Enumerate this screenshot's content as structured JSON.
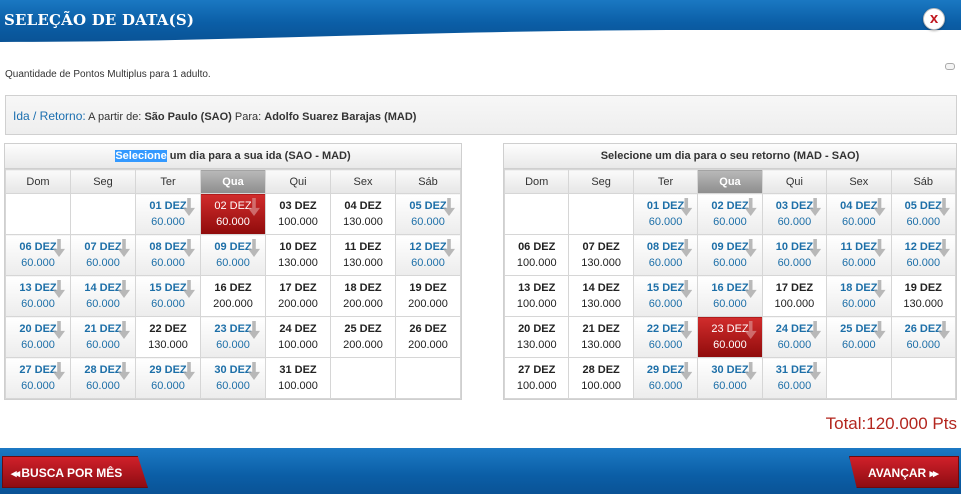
{
  "header": {
    "title": "SELEÇÃO DE DATA(S)",
    "close_label": "x"
  },
  "points_note": "Quantidade de Pontos Multiplus para 1 adulto.",
  "route": {
    "label": "Ida / Retorno:",
    "from_prefix": "A partir de:",
    "from": "São Paulo (SAO)",
    "to_prefix": "Para:",
    "to": "Adolfo Suarez Barajas (MAD)"
  },
  "weekdays": [
    "Dom",
    "Seg",
    "Ter",
    "Qua",
    "Qui",
    "Sex",
    "Sáb"
  ],
  "today_col": 3,
  "ida": {
    "caption_highlight": "Selecione",
    "caption_rest": " um dia para a sua ida (SAO - MAD)",
    "rows": [
      [
        null,
        null,
        {
          "d": "01 DEZ",
          "p": "60.000",
          "s": "avail"
        },
        {
          "d": "02 DEZ",
          "p": "60.000",
          "s": "sel"
        },
        {
          "d": "03 DEZ",
          "p": "100.000",
          "s": "plain"
        },
        {
          "d": "04 DEZ",
          "p": "130.000",
          "s": "plain"
        },
        {
          "d": "05 DEZ",
          "p": "60.000",
          "s": "avail"
        }
      ],
      [
        {
          "d": "06 DEZ",
          "p": "60.000",
          "s": "avail"
        },
        {
          "d": "07 DEZ",
          "p": "60.000",
          "s": "avail"
        },
        {
          "d": "08 DEZ",
          "p": "60.000",
          "s": "avail"
        },
        {
          "d": "09 DEZ",
          "p": "60.000",
          "s": "avail"
        },
        {
          "d": "10 DEZ",
          "p": "130.000",
          "s": "plain"
        },
        {
          "d": "11 DEZ",
          "p": "130.000",
          "s": "plain"
        },
        {
          "d": "12 DEZ",
          "p": "60.000",
          "s": "avail"
        }
      ],
      [
        {
          "d": "13 DEZ",
          "p": "60.000",
          "s": "avail"
        },
        {
          "d": "14 DEZ",
          "p": "60.000",
          "s": "avail"
        },
        {
          "d": "15 DEZ",
          "p": "60.000",
          "s": "avail"
        },
        {
          "d": "16 DEZ",
          "p": "200.000",
          "s": "plain"
        },
        {
          "d": "17 DEZ",
          "p": "200.000",
          "s": "plain"
        },
        {
          "d": "18 DEZ",
          "p": "200.000",
          "s": "plain"
        },
        {
          "d": "19 DEZ",
          "p": "200.000",
          "s": "plain"
        }
      ],
      [
        {
          "d": "20 DEZ",
          "p": "60.000",
          "s": "avail"
        },
        {
          "d": "21 DEZ",
          "p": "60.000",
          "s": "avail"
        },
        {
          "d": "22 DEZ",
          "p": "130.000",
          "s": "plain"
        },
        {
          "d": "23 DEZ",
          "p": "60.000",
          "s": "avail"
        },
        {
          "d": "24 DEZ",
          "p": "100.000",
          "s": "plain"
        },
        {
          "d": "25 DEZ",
          "p": "200.000",
          "s": "plain"
        },
        {
          "d": "26 DEZ",
          "p": "200.000",
          "s": "plain"
        }
      ],
      [
        {
          "d": "27 DEZ",
          "p": "60.000",
          "s": "avail"
        },
        {
          "d": "28 DEZ",
          "p": "60.000",
          "s": "avail"
        },
        {
          "d": "29 DEZ",
          "p": "60.000",
          "s": "avail"
        },
        {
          "d": "30 DEZ",
          "p": "60.000",
          "s": "avail"
        },
        {
          "d": "31 DEZ",
          "p": "100.000",
          "s": "plain"
        },
        null,
        null
      ]
    ]
  },
  "retorno": {
    "caption": "Selecione um dia para o seu retorno (MAD - SAO)",
    "rows": [
      [
        null,
        null,
        {
          "d": "01 DEZ",
          "p": "60.000",
          "s": "avail"
        },
        {
          "d": "02 DEZ",
          "p": "60.000",
          "s": "avail"
        },
        {
          "d": "03 DEZ",
          "p": "60.000",
          "s": "avail"
        },
        {
          "d": "04 DEZ",
          "p": "60.000",
          "s": "avail"
        },
        {
          "d": "05 DEZ",
          "p": "60.000",
          "s": "avail"
        }
      ],
      [
        {
          "d": "06 DEZ",
          "p": "100.000",
          "s": "plain"
        },
        {
          "d": "07 DEZ",
          "p": "130.000",
          "s": "plain"
        },
        {
          "d": "08 DEZ",
          "p": "60.000",
          "s": "avail"
        },
        {
          "d": "09 DEZ",
          "p": "60.000",
          "s": "avail"
        },
        {
          "d": "10 DEZ",
          "p": "60.000",
          "s": "avail"
        },
        {
          "d": "11 DEZ",
          "p": "60.000",
          "s": "avail"
        },
        {
          "d": "12 DEZ",
          "p": "60.000",
          "s": "avail"
        }
      ],
      [
        {
          "d": "13 DEZ",
          "p": "100.000",
          "s": "plain"
        },
        {
          "d": "14 DEZ",
          "p": "130.000",
          "s": "plain"
        },
        {
          "d": "15 DEZ",
          "p": "60.000",
          "s": "avail"
        },
        {
          "d": "16 DEZ",
          "p": "60.000",
          "s": "avail"
        },
        {
          "d": "17 DEZ",
          "p": "100.000",
          "s": "plain"
        },
        {
          "d": "18 DEZ",
          "p": "60.000",
          "s": "avail"
        },
        {
          "d": "19 DEZ",
          "p": "130.000",
          "s": "plain"
        }
      ],
      [
        {
          "d": "20 DEZ",
          "p": "130.000",
          "s": "plain"
        },
        {
          "d": "21 DEZ",
          "p": "130.000",
          "s": "plain"
        },
        {
          "d": "22 DEZ",
          "p": "60.000",
          "s": "avail"
        },
        {
          "d": "23 DEZ",
          "p": "60.000",
          "s": "sel"
        },
        {
          "d": "24 DEZ",
          "p": "60.000",
          "s": "avail"
        },
        {
          "d": "25 DEZ",
          "p": "60.000",
          "s": "avail"
        },
        {
          "d": "26 DEZ",
          "p": "60.000",
          "s": "avail"
        }
      ],
      [
        {
          "d": "27 DEZ",
          "p": "100.000",
          "s": "plain"
        },
        {
          "d": "28 DEZ",
          "p": "100.000",
          "s": "plain"
        },
        {
          "d": "29 DEZ",
          "p": "60.000",
          "s": "avail"
        },
        {
          "d": "30 DEZ",
          "p": "60.000",
          "s": "avail"
        },
        {
          "d": "31 DEZ",
          "p": "60.000",
          "s": "avail"
        },
        null,
        null
      ]
    ]
  },
  "total": "Total:120.000 Pts",
  "footer": {
    "back_label": "BUSCA POR MÊS",
    "next_label": "AVANÇAR"
  },
  "colors": {
    "brand_blue": "#0b5ea6",
    "accent_red": "#b3261e",
    "link_blue": "#1d6fa8"
  }
}
